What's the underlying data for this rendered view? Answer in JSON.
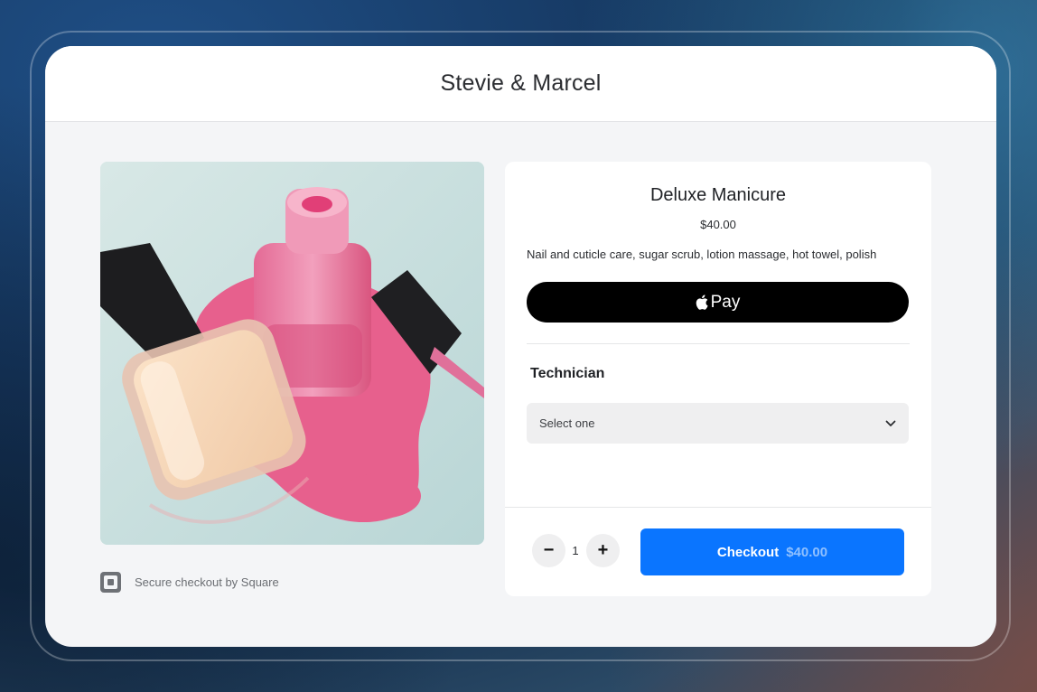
{
  "store": {
    "title": "Stevie & Marcel"
  },
  "product": {
    "name": "Deluxe Manicure",
    "price": "$40.00",
    "description": "Nail and cuticle care, sugar scrub, lotion massage, hot towel, polish",
    "image_icon": "nail-polish-photo"
  },
  "payment": {
    "apple_pay_label": "Pay",
    "apple_icon": "apple-logo-icon"
  },
  "technician": {
    "label": "Technician",
    "select_value": "Select one"
  },
  "quantity": {
    "value": "1",
    "minus_label": "−",
    "plus_label": "+"
  },
  "checkout": {
    "label": "Checkout",
    "price": "$40.00"
  },
  "footer": {
    "secure_text": "Secure checkout by Square",
    "square_icon": "square-logo-icon"
  },
  "colors": {
    "accent": "#0a75ff",
    "apple_pay_bg": "#000000",
    "screen_bg": "#f4f5f7"
  }
}
